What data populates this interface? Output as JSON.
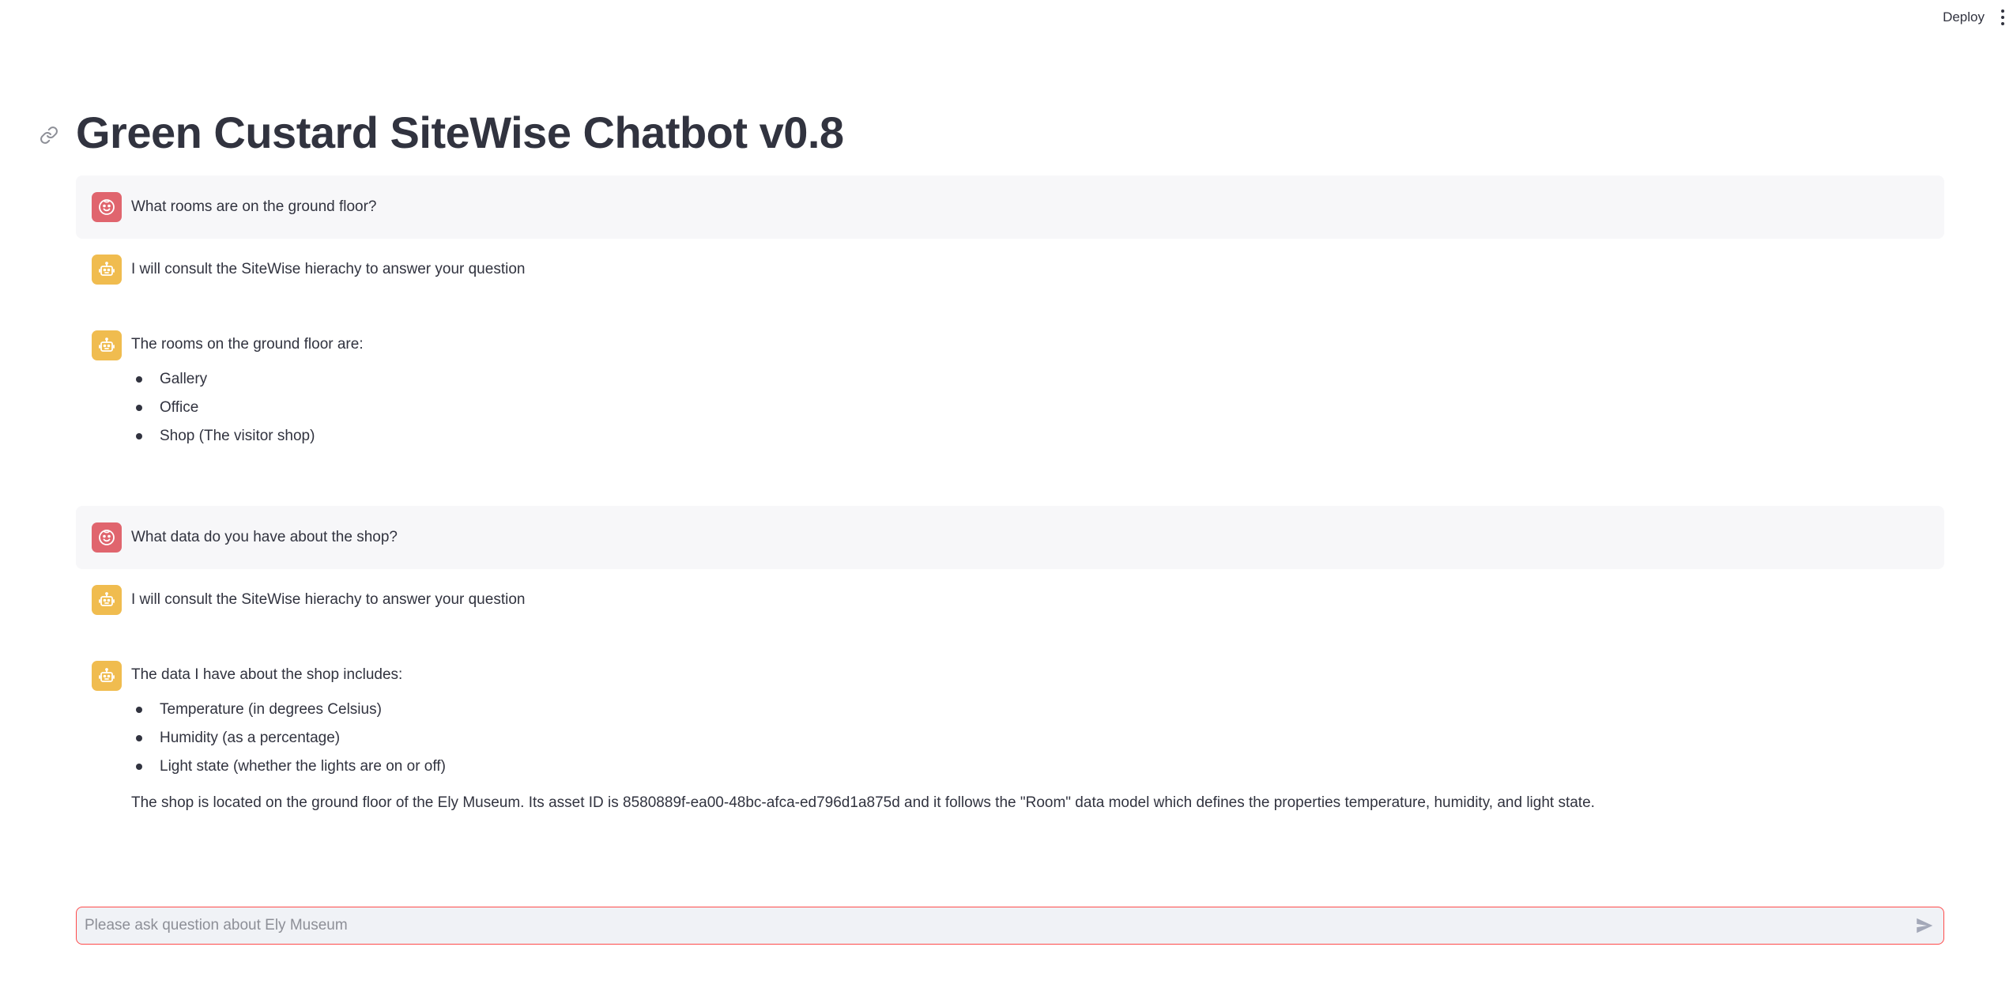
{
  "header": {
    "deploy_label": "Deploy",
    "menu_icon": "kebab-menu-icon"
  },
  "title": {
    "text": "Green Custard SiteWise Chatbot v0.8",
    "anchor_icon": "link-icon"
  },
  "messages": [
    {
      "role": "user",
      "avatar_icon": "user-face-icon",
      "text": "What rooms are on the ground floor?"
    },
    {
      "role": "assistant",
      "avatar_icon": "robot-icon",
      "text": "I will consult the SiteWise hierachy to answer your question"
    },
    {
      "role": "assistant",
      "avatar_icon": "robot-icon",
      "text": "The rooms on the ground floor are:",
      "bullets": [
        "Gallery",
        "Office",
        "Shop (The visitor shop)"
      ]
    },
    {
      "role": "user",
      "avatar_icon": "user-face-icon",
      "text": "What data do you have about the shop?"
    },
    {
      "role": "assistant",
      "avatar_icon": "robot-icon",
      "text": "I will consult the SiteWise hierachy to answer your question"
    },
    {
      "role": "assistant",
      "avatar_icon": "robot-icon",
      "text": "The data I have about the shop includes:",
      "bullets": [
        "Temperature (in degrees Celsius)",
        "Humidity (as a percentage)",
        "Light state (whether the lights are on or off)"
      ],
      "footer": "The shop is located on the ground floor of the Ely Museum. Its asset ID is 8580889f-ea00-48bc-afca-ed796d1a875d and it follows the \"Room\" data model which defines the properties temperature, humidity, and light state."
    }
  ],
  "chat_input": {
    "placeholder": "Please ask question about Ely Museum",
    "value": "",
    "send_icon": "send-icon"
  },
  "colors": {
    "user_avatar": "#e0656e",
    "assistant_avatar": "#f0bc4f",
    "input_border": "#ff4b4b",
    "text": "#31333f"
  }
}
